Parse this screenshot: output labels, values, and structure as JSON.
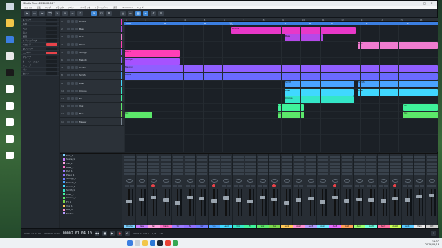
{
  "window": {
    "title": "Studio One - 2024-05-18*",
    "controls": {
      "minimize": "–",
      "maximize": "□",
      "close": "×"
    }
  },
  "menubar": [
    "ファイル",
    "編集",
    "ソング",
    "トラック",
    "イベント",
    "オーディオ",
    "トランスポート",
    "表示",
    "Studio One",
    "ヘルプ"
  ],
  "transport": {
    "time": "00002.01.04.10",
    "tempo": "120",
    "signature": "4 / 4",
    "position": "00002.01.04.10",
    "loop_start": "00001.01.01.00",
    "loop_end": "00009.01.01.00"
  },
  "taskbar": {
    "clock_time": "19:32",
    "clock_date": "2024/05/18"
  },
  "ruler_ticks": [
    "1",
    "2",
    "3",
    "4",
    "5",
    "6",
    "7",
    "8",
    "9",
    "10",
    "11",
    "12",
    "13",
    "14",
    "15",
    "16"
  ],
  "markers": [
    "Intro",
    "A",
    "B",
    "サビ",
    "A",
    "B",
    "C",
    "D",
    "E"
  ],
  "tracks": [
    {
      "num": "1",
      "name": "Drums",
      "color": "#e838c8"
    },
    {
      "num": "2",
      "name": "Bass",
      "color": "#b549e8"
    },
    {
      "num": "3",
      "name": "Pad",
      "color": "#f07cd0"
    },
    {
      "num": "4",
      "name": "Piano",
      "color": "#ff3fb6"
    },
    {
      "num": "5",
      "name": "Strings",
      "color": "#a652ff"
    },
    {
      "num": "6",
      "name": "Melody",
      "color": "#8f5fff"
    },
    {
      "num": "7",
      "name": "Guitar",
      "color": "#6a6aff"
    },
    {
      "num": "8",
      "name": "Synth",
      "color": "#4aa3ff"
    },
    {
      "num": "9",
      "name": "Lead",
      "color": "#40d8ff"
    },
    {
      "num": "10",
      "name": "Chorus",
      "color": "#34e6c8"
    },
    {
      "num": "11",
      "name": "FX",
      "color": "#3ff29a"
    },
    {
      "num": "12",
      "name": "Vox",
      "color": "#5ce86a"
    },
    {
      "num": "13",
      "name": "Bus",
      "color": "#7ad64b"
    },
    {
      "num": "14",
      "name": "Master",
      "color": "#7a8590"
    }
  ],
  "mixer_browser": [
    "Kick_1",
    "Snare_1",
    "Hat_1",
    "Bass_1",
    "Pad_1",
    "Piano_1",
    "Strings_1",
    "Melody_1",
    "Guitar_1",
    "Synth_1",
    "Lead_1",
    "Chorus_1",
    "FX_1",
    "Vox_1",
    "Bus_1",
    "Master"
  ],
  "strip_labels": [
    "Drums",
    "Bass",
    "Pad",
    "Piano",
    "Str",
    "Mel",
    "Gtr",
    "Syn",
    "Lead",
    "Cho",
    "FX",
    "Vox",
    "Bus",
    "Aux1",
    "Aux2",
    "Aux3",
    "Aux4",
    "Aux5",
    "Aux6",
    "Aux7",
    "Aux8",
    "Aux9",
    "Aux10",
    "Aux11",
    "Main",
    "Out"
  ],
  "strip_colors": [
    "#7bd0ff",
    "#c77dff",
    "#ffa3e0",
    "#ff70c8",
    "#9b7bff",
    "#8f6fff",
    "#6f7bff",
    "#4aa3ff",
    "#40d8ff",
    "#34e6c8",
    "#3ff29a",
    "#5ce86a",
    "#7ad64b",
    "#ffc857",
    "#ff8fd1",
    "#b49bff",
    "#6ee7ff",
    "#e66bff",
    "#ff9e57",
    "#9cff6e",
    "#6effe0",
    "#ff6e9e",
    "#c8ff57",
    "#57c8ff",
    "#e8e8e8",
    "#d0d0d0"
  ],
  "strip_levels": [
    0.55,
    0.62,
    0.7,
    0.6,
    0.5,
    0.72,
    0.65,
    0.58,
    0.68,
    0.6,
    0.55,
    0.7,
    0.62,
    0.5,
    0.6,
    0.66,
    0.52,
    0.7,
    0.58,
    0.64,
    0.61,
    0.57,
    0.66,
    0.6,
    0.75,
    0.8
  ],
  "inspector": {
    "rows": [
      "トラック",
      "名前",
      "入力",
      "出力",
      "遅延",
      "トランスポーズ",
      "ベロシティ",
      "タイミング",
      "レイヤー",
      "グループ",
      "オートメーション",
      "フェーダー",
      "パン",
      "センド"
    ]
  }
}
